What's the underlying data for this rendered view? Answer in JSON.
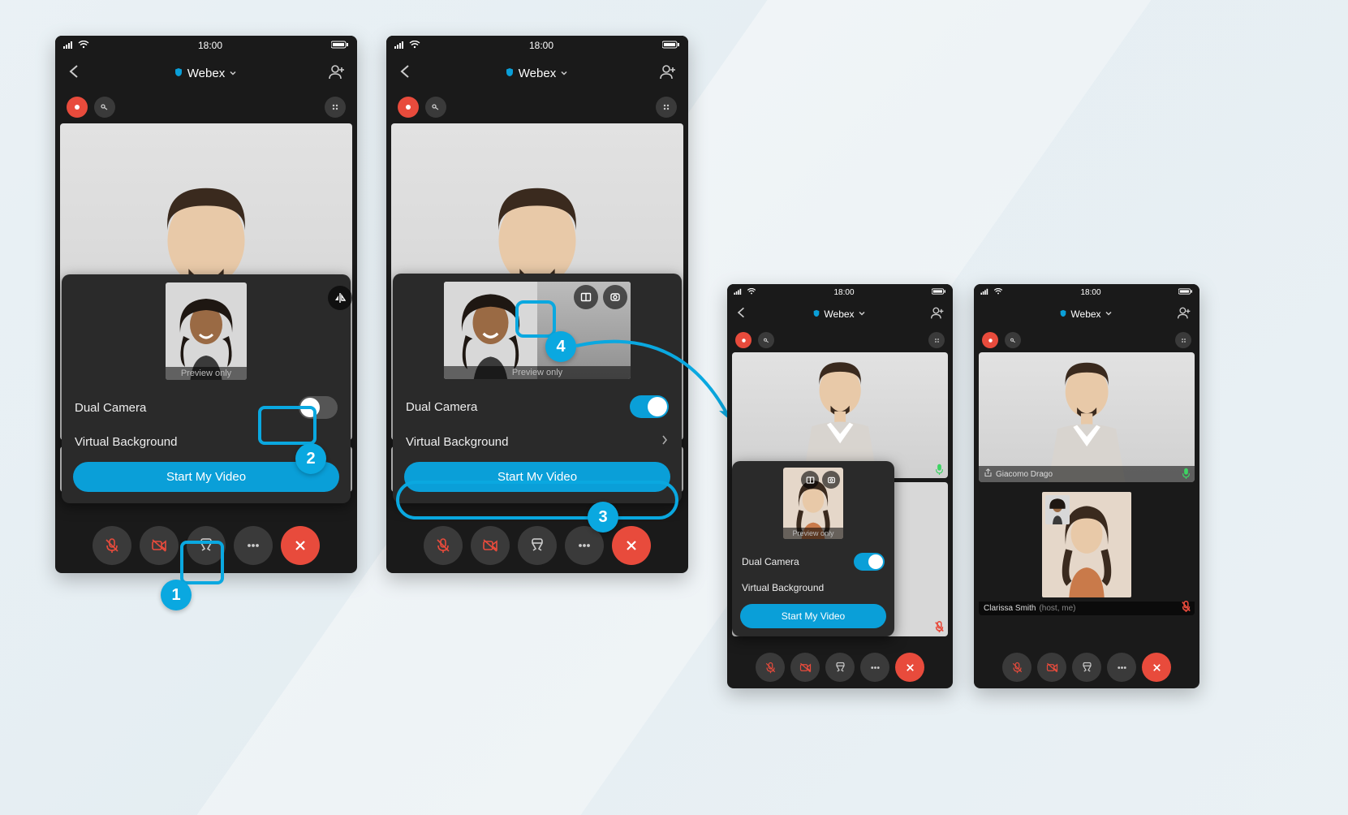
{
  "status": {
    "time": "18:00"
  },
  "header": {
    "title": "Webex"
  },
  "popup": {
    "preview_label": "Preview only",
    "dual_camera_label": "Dual Camera",
    "virtual_bg_label": "Virtual Background",
    "start_label": "Start My Video"
  },
  "participants": {
    "p1_name": "Giacomo Drago",
    "p2_name": "Clarissa Smith",
    "p2_suffix": "(host, me)"
  },
  "callouts": {
    "n1": "1",
    "n2": "2",
    "n3": "3",
    "n4": "4"
  }
}
